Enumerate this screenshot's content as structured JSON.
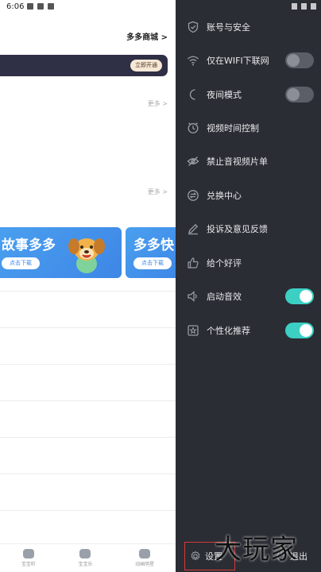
{
  "status_bar": {
    "time": "6:06"
  },
  "background_page": {
    "mall_link": "多多商城 >",
    "vip_button": "立即开通",
    "more_1": "更多 >",
    "more_2": "更多 >",
    "banners": [
      {
        "title": "故事多多",
        "button": "点击下载"
      },
      {
        "title": "多多快",
        "button": "点击下载"
      }
    ],
    "bottom_nav": [
      {
        "label": "宝宝听",
        "icon": "headphones-icon"
      },
      {
        "label": "宝宝乐",
        "icon": "robot-icon"
      },
      {
        "label": "动画明星",
        "icon": "bear-icon"
      }
    ]
  },
  "drawer": {
    "items": [
      {
        "label": "账号与安全",
        "icon": "shield-icon"
      },
      {
        "label": "仅在WIFI下联网",
        "icon": "wifi-icon",
        "toggle": "off"
      },
      {
        "label": "夜间模式",
        "icon": "moon-icon",
        "toggle": "off"
      },
      {
        "label": "视频时间控制",
        "icon": "clock-icon"
      },
      {
        "label": "禁止音视频片单",
        "icon": "eye-off-icon"
      },
      {
        "label": "兑换中心",
        "icon": "exchange-icon"
      },
      {
        "label": "投诉及意见反馈",
        "icon": "pencil-icon"
      },
      {
        "label": "给个好评",
        "icon": "thumbs-up-icon"
      },
      {
        "label": "启动音效",
        "icon": "speaker-icon",
        "toggle": "on"
      },
      {
        "label": "个性化推荐",
        "icon": "star-box-icon",
        "toggle": "on"
      }
    ],
    "footer": {
      "settings_label": "设置",
      "exit_label": "退出"
    },
    "colors": {
      "background": "#2a2d34",
      "toggle_on": "#3ccfc4",
      "toggle_off": "#5b5e66",
      "highlight_border": "#d43a3a"
    }
  },
  "watermark": "大玩家"
}
